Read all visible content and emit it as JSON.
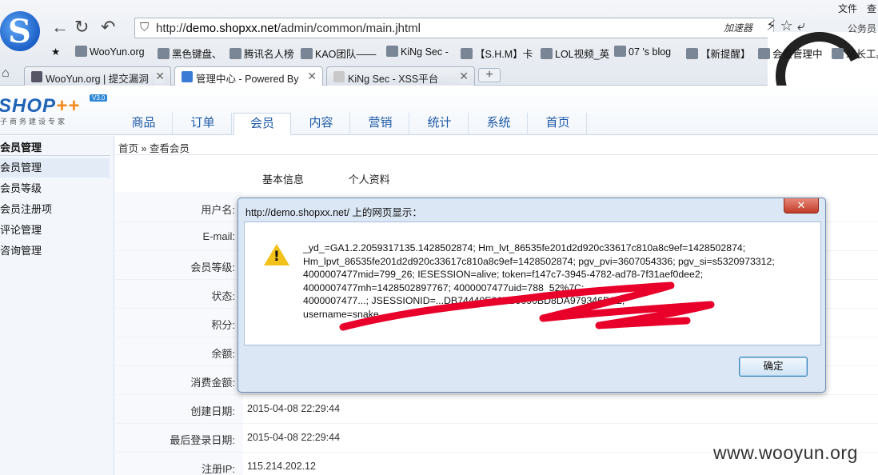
{
  "browser": {
    "logo_glyph": "S",
    "nav": {
      "back": "←",
      "refresh": "↻",
      "undo": "↶"
    },
    "url_prefix": "http://",
    "url_host": "demo.shopxx.net",
    "url_path": "/admin/common/main.jhtml",
    "accelerator": "加速器",
    "right_tools": "⚡ ☆ ⤶",
    "menu_file": "文件",
    "menu_view": "查",
    "account": "公务员",
    "bookmarks": [
      "WooYun.org",
      "黑色键盘、",
      "腾讯名人榜",
      "KAO团队——",
      "KiNg Sec -",
      "【S.H.M】卡",
      "LOL视频_英",
      "07 's blog",
      "【新提醒】",
      "会员管理中",
      "站长工具"
    ],
    "tabs": [
      {
        "label": "WooYun.org | 提交漏洞",
        "active": false
      },
      {
        "label": "管理中心 - Powered By",
        "active": true
      },
      {
        "label": "KiNg Sec - XSS平台",
        "active": false
      }
    ],
    "new_tab": "+",
    "tab_close": "✕"
  },
  "app": {
    "logo_main": "SHOP",
    "logo_plus": "++",
    "logo_version": "V3.0",
    "logo_sub": "子商务建设专家",
    "nav": [
      "商品",
      "订单",
      "会员",
      "内容",
      "营销",
      "统计",
      "系统",
      "首页"
    ],
    "active_nav": "会员"
  },
  "sidebar": {
    "title": "会员管理",
    "items": [
      "会员管理",
      "会员等级",
      "会员注册项",
      "评论管理",
      "咨询管理"
    ]
  },
  "breadcrumb": "首页 » 查看会员",
  "subtabs": [
    "基本信息",
    "个人资料"
  ],
  "form": {
    "rows": [
      {
        "label": "用户名:",
        "value": ""
      },
      {
        "label": "E-mail:",
        "value": ""
      },
      {
        "label": "会员等级:",
        "value": ""
      },
      {
        "label": "状态:",
        "value": ""
      },
      {
        "label": "积分:",
        "value": ""
      },
      {
        "label": "余额:",
        "value": ""
      },
      {
        "label": "消费金额:",
        "value": ""
      },
      {
        "label": "创建日期:",
        "value": "2015-04-08 22:29:44"
      },
      {
        "label": "最后登录日期:",
        "value": "2015-04-08 22:29:44"
      },
      {
        "label": "注册IP:",
        "value": "115.214.202.12"
      }
    ]
  },
  "dialog": {
    "title": "http://demo.shopxx.net/ 上的网页显示：",
    "close": "✕",
    "lines": [
      "_yd_=GA1.2.2059317135.1428502874; Hm_lvt_86535fe201d2d920c33617c810a8c9ef=1428502874;",
      "Hm_lpvt_86535fe201d2d920c33617c810a8c9ef=1428502874; pgv_pvi=3607054336; pgv_si=s5320973312;",
      "4000007477mid=799_26; IESESSION=alive; token=f147c7-3945-4782-ad78-7f31aef0dee2;",
      "4000007477mh=1428502897767; 4000007477uid=788_52%7C;",
      "4000007477...; JSESSIONID=...DB74440E26EB9090BD8DA979346D9E;",
      "username=snake"
    ],
    "ok": "确定",
    "scribble_color": "#e8002a"
  },
  "watermark": "www.wooyun.org"
}
